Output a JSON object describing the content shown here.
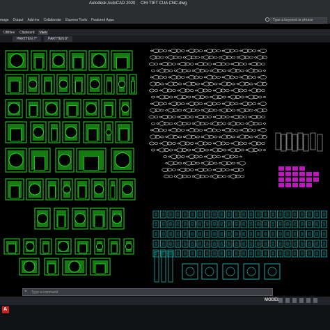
{
  "window": {
    "title": "Autodesk AutoCAD 2020",
    "file": "CHI TIET CUA CNC.dwg"
  },
  "menu": [
    "mage",
    "Output",
    "Add-ins",
    "Collaborate",
    "Express Tools",
    "Featured Apps"
  ],
  "search": {
    "placeholder": "Type a keyword or phrase"
  },
  "ribbon_tabs": [
    {
      "label": "Utilities"
    },
    {
      "label": "Clipboard"
    },
    {
      "label": "View"
    }
  ],
  "doc_tabs": [
    "PARTTEN 7*",
    "PARTTEN 8*"
  ],
  "command": {
    "prompt": "Type a command"
  },
  "status": {
    "model": "MODEL"
  },
  "colors": {
    "green_frames": "#22e01c",
    "white_patterns": "#e8e8e8",
    "cyan_tiles": "#1fb5b5",
    "magenta_set": "#e01be0",
    "gray_panels": "#9c9c9c"
  }
}
